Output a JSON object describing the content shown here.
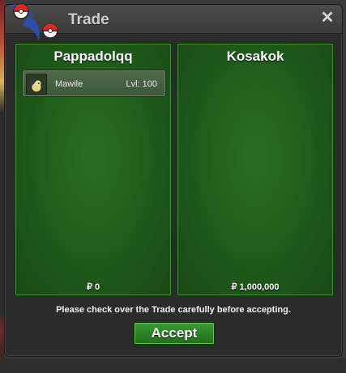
{
  "window": {
    "title": "Trade",
    "close_icon": "close-icon",
    "logo_icon": "pokeball-logo-icon"
  },
  "left_panel": {
    "player_name": "Pappadolqq",
    "money": "₽ 0",
    "pokemon": [
      {
        "name": "Mawile",
        "level": "Lvl: 100",
        "icon": "mawile-sprite-icon"
      }
    ]
  },
  "right_panel": {
    "player_name": "Kosakok",
    "money": "₽ 1,000,000",
    "pokemon": []
  },
  "footer": {
    "notice": "Please check over the Trade carefully before accepting.",
    "accept_label": "Accept"
  },
  "colors": {
    "panel_green": "#1f5a1a",
    "button_green": "#2e8a28",
    "window_bg": "#2b2b2b"
  }
}
